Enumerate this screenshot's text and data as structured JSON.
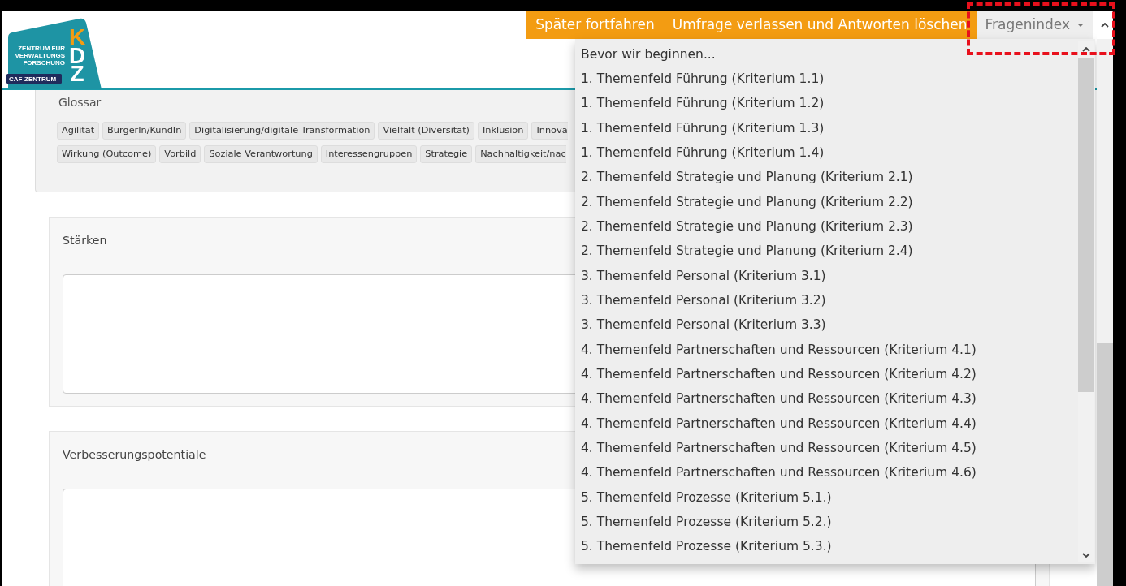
{
  "header": {
    "logo": {
      "lines": [
        "ZENTRUM FÜR",
        "VERWALTUNGS",
        "FORSCHUNG"
      ],
      "badge": "CAF-ZENTRUM",
      "letters": [
        {
          "text": "K",
          "color": "#f39c12"
        },
        {
          "text": "D",
          "color": "#ffffff"
        },
        {
          "text": "Z",
          "color": "#ffffff"
        }
      ]
    },
    "nav": {
      "links": [
        "Später fortfahren",
        "Umfrage verlassen und Antworten löschen"
      ],
      "question_index": {
        "label": "Fragenindex",
        "expanded": true,
        "items": [
          {
            "label": "Bevor wir beginnen..."
          },
          {
            "label": "1. Themenfeld Führung (Kriterium 1.1)"
          },
          {
            "label": "1. Themenfeld Führung (Kriterium 1.2)"
          },
          {
            "label": "1. Themenfeld Führung (Kriterium 1.3)"
          },
          {
            "label": "1. Themenfeld Führung (Kriterium 1.4)"
          },
          {
            "label": "2. Themenfeld Strategie und Planung (Kriterium 2.1)"
          },
          {
            "label": "2. Themenfeld Strategie und Planung (Kriterium 2.2)"
          },
          {
            "label": "2. Themenfeld Strategie und Planung (Kriterium 2.3)"
          },
          {
            "label": "2. Themenfeld Strategie und Planung (Kriterium 2.4)"
          },
          {
            "label": "3. Themenfeld Personal (Kriterium 3.1)"
          },
          {
            "label": "3. Themenfeld Personal (Kriterium 3.2)"
          },
          {
            "label": "3. Themenfeld Personal (Kriterium 3.3)"
          },
          {
            "label": "4. Themenfeld Partnerschaften und Ressourcen (Kriterium 4.1)"
          },
          {
            "label": "4. Themenfeld Partnerschaften und Ressourcen (Kriterium 4.2)"
          },
          {
            "label": "4. Themenfeld Partnerschaften und Ressourcen (Kriterium 4.3)"
          },
          {
            "label": "4. Themenfeld Partnerschaften und Ressourcen (Kriterium 4.4)"
          },
          {
            "label": "4. Themenfeld Partnerschaften und Ressourcen (Kriterium 4.5)"
          },
          {
            "label": "4. Themenfeld Partnerschaften und Ressourcen (Kriterium 4.6)"
          },
          {
            "label": "5. Themenfeld Prozesse (Kriterium 5.1.)"
          },
          {
            "label": "5. Themenfeld Prozesse (Kriterium 5.2.)"
          },
          {
            "label": "5. Themenfeld Prozesse (Kriterium 5.3.)"
          }
        ]
      }
    }
  },
  "glossary": {
    "title": "Glossar",
    "tag_rows": [
      [
        "Agilität",
        "BürgerIn/KundIn",
        "Digitalisierung/digitale Transformation",
        "Vielfalt (Diversität)",
        "Inklusion",
        "Innova"
      ],
      [
        "Wirkung (Outcome)",
        "Vorbild",
        "Soziale Verantwortung",
        "Interessengruppen",
        "Strategie",
        "Nachhaltigkeit/nac"
      ]
    ]
  },
  "panels": [
    {
      "label": "Stärken"
    },
    {
      "label": "Verbesserungspotentiale"
    }
  ],
  "annotation": {
    "kind": "dashed-frame"
  }
}
